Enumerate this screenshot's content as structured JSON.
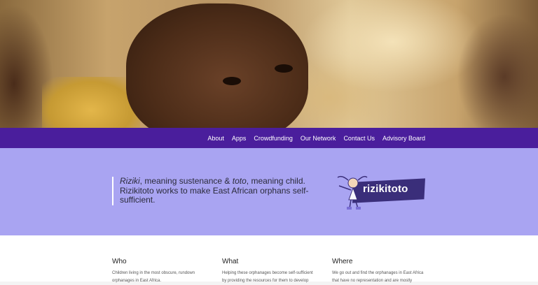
{
  "nav": {
    "items": [
      "About",
      "Apps",
      "Crowdfunding",
      "Our Network",
      "Contact Us",
      "Advisory Board"
    ]
  },
  "intro": {
    "riziki": "Riziki",
    "line1_mid": ", meaning sustenance & ",
    "toto": "toto",
    "line1_end": ", meaning child.",
    "line2": "Rizikitoto works to make East African orphans self-sufficient."
  },
  "logo": {
    "text": "rizikitoto"
  },
  "columns": [
    {
      "title": "Who",
      "text": "Children living in the most obscure, rundown orphanages in East Africa."
    },
    {
      "title": "What",
      "text": "Helping these orphanages become self-sufficient by providing the resources for them to develop"
    },
    {
      "title": "Where",
      "text": "We go out and find the orphanages in East Africa that have no representation and are mostly"
    }
  ],
  "colors": {
    "nav": "#4a1e9c",
    "intro": "#a9a4f2",
    "logo_tag": "#3a2e7a"
  }
}
